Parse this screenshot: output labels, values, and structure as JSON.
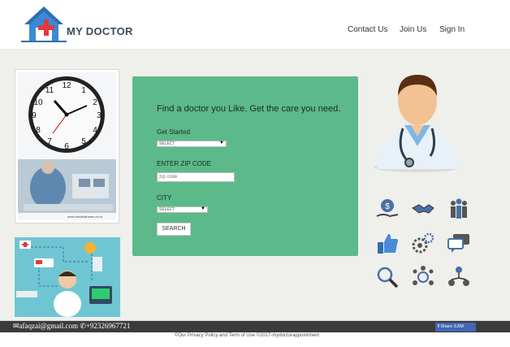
{
  "brand": {
    "name": "MY DOCTOR",
    "house_color": "#2f6db5",
    "cross_color": "#e03a3a"
  },
  "nav": {
    "contact": "Contact Us",
    "join": "Join Us",
    "signin": "Sign In"
  },
  "clock_card": {
    "watermark": "www.drsvellaharan.co.in"
  },
  "search": {
    "title": "Find a doctor you Like. Get the care you need.",
    "get_started_label": "Get Started",
    "get_started_select": "SELECT",
    "zip_label": "ENTER ZIP CODE",
    "zip_placeholder": "zip code",
    "city_label": "CITY",
    "city_select": "SELECT",
    "button": "SEARCH"
  },
  "services_icons": [
    "money-hand-icon",
    "handshake-icon",
    "group-icon",
    "thumbs-up-icon",
    "gears-icon",
    "chat-icon",
    "magnifier-icon",
    "network-icon",
    "org-chart-icon"
  ],
  "footer": {
    "email": "afaqzai@gmail.com",
    "phone": "+92326967721",
    "share": "Share 3.6M",
    "copyright": "©Our Privacy Policy and Term of Use ©2017-mydoctorappointment"
  },
  "colors": {
    "panel": "#5cb98a",
    "background": "#efefec",
    "footer": "#3b3b3b",
    "facebook": "#4267b2"
  }
}
